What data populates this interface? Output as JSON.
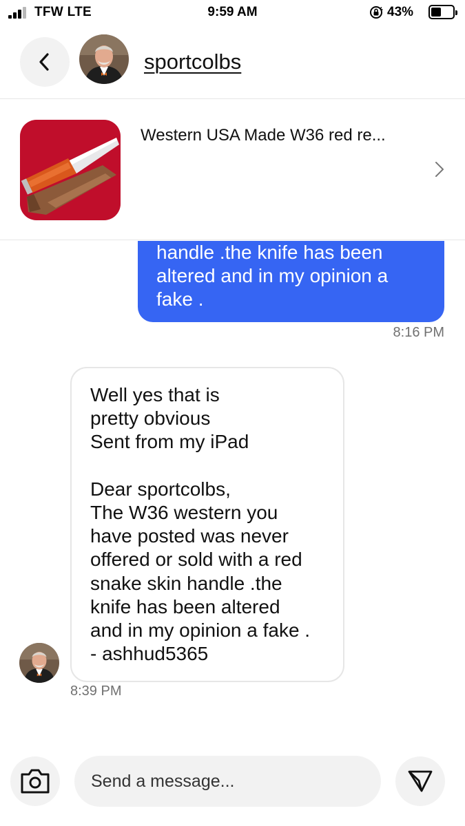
{
  "status_bar": {
    "carrier": "TFW  LTE",
    "time": "9:59 AM",
    "battery_percent": "43%",
    "battery_level": 0.43,
    "icons": [
      "signal-icon",
      "orientation-lock-icon",
      "battery-icon"
    ]
  },
  "header": {
    "username": "sportcolbs",
    "icons": [
      "back-chevron-icon",
      "avatar"
    ]
  },
  "listing": {
    "title": "Western USA Made W36 red re...",
    "icons": [
      "knife-thumbnail",
      "chevron-right-icon"
    ]
  },
  "messages": {
    "outgoing": {
      "lines": [
        "handle .the knife has been",
        "altered and in my opinion a",
        "fake ."
      ],
      "time": "8:16 PM"
    },
    "incoming": {
      "lines": [
        "Well yes that is",
        "pretty obvious",
        "Sent from my iPad",
        "",
        "Dear sportcolbs,",
        "The W36 western you",
        "have posted was never",
        "offered or sold with a red",
        "snake skin handle .the",
        "knife has been altered",
        "and in my opinion a fake .",
        "- ashhud5365"
      ],
      "time": "8:39 PM"
    }
  },
  "composer": {
    "placeholder": "Send a message...",
    "value": "",
    "icons": [
      "camera-icon",
      "send-icon"
    ]
  },
  "colors": {
    "accent_blue": "#3665f3",
    "bubble_border": "#e6e6e6",
    "button_bg": "#f2f2f2",
    "timestamp": "#707070"
  }
}
